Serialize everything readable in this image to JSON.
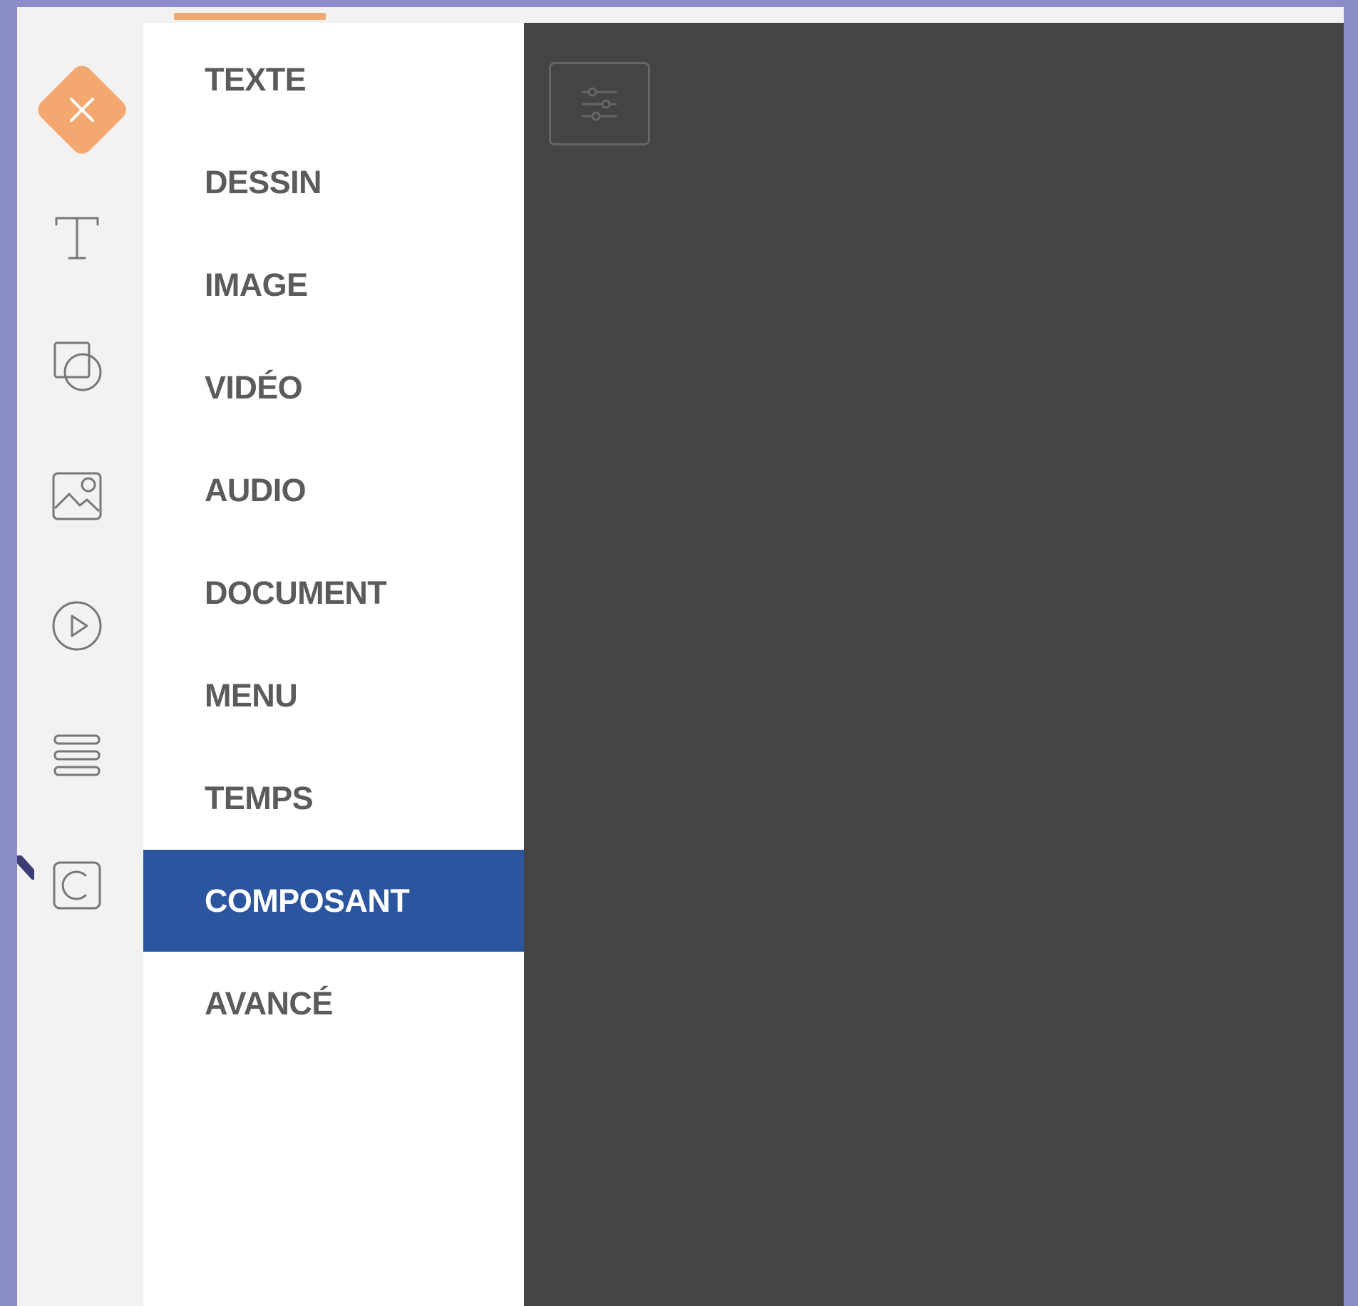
{
  "colors": {
    "outer_background": "#8a8dc8",
    "rail_background": "#f2f2f2",
    "menu_background": "#ffffff",
    "content_background": "#444444",
    "accent_orange": "#f3a86f",
    "active_blue": "#2c55a0",
    "menu_text": "#5b5b5b",
    "active_text": "#ffffff",
    "icon_gray": "#666666"
  },
  "icons": {
    "close": "close-icon",
    "text": "text-icon",
    "shapes": "shapes-icon",
    "image": "image-icon",
    "video": "video-play-icon",
    "menu": "menu-lines-icon",
    "component": "component-icon",
    "settings": "settings-sliders-icon"
  },
  "menu": {
    "items": [
      {
        "label": "TEXTE",
        "active": false
      },
      {
        "label": "DESSIN",
        "active": false
      },
      {
        "label": "IMAGE",
        "active": false
      },
      {
        "label": "VIDÉO",
        "active": false
      },
      {
        "label": "AUDIO",
        "active": false
      },
      {
        "label": "DOCUMENT",
        "active": false
      },
      {
        "label": "MENU",
        "active": false
      },
      {
        "label": "TEMPS",
        "active": false
      },
      {
        "label": "COMPOSANT",
        "active": true
      },
      {
        "label": "AVANCÉ",
        "active": false
      }
    ]
  }
}
